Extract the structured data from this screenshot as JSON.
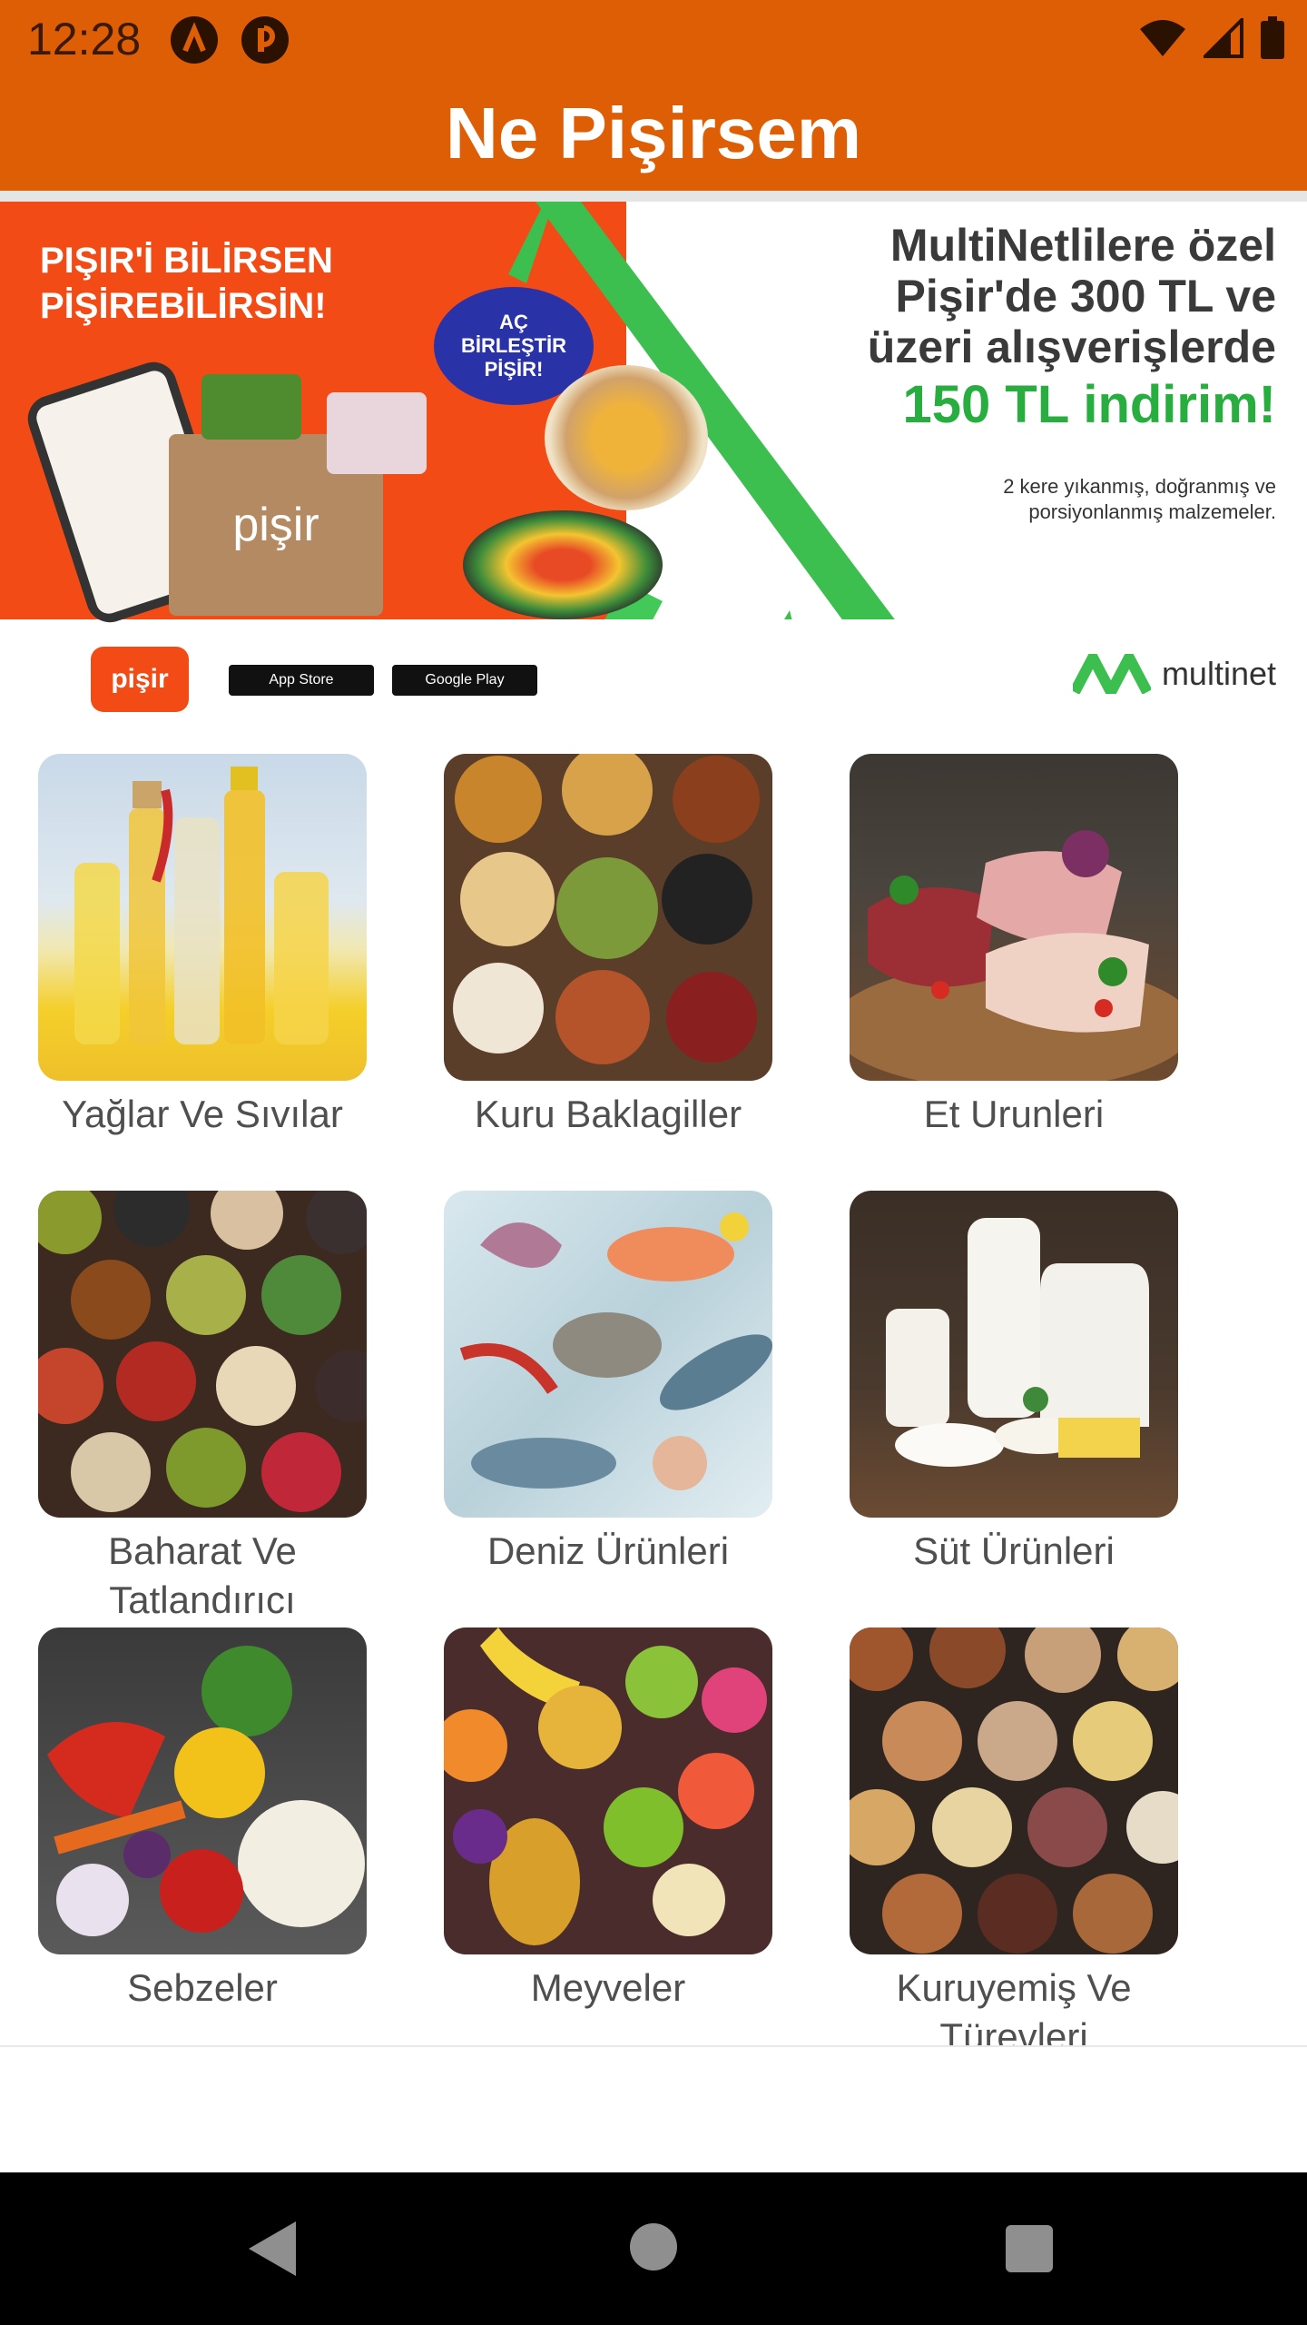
{
  "status_bar": {
    "time": "12:28",
    "left_icons": [
      "a-circle-icon",
      "p-circle-icon"
    ],
    "right_icons": [
      "wifi-icon",
      "signal-icon",
      "battery-icon"
    ]
  },
  "app_bar": {
    "title": "Ne Pişirsem"
  },
  "banner": {
    "headline_line1": "PIŞIR'İ BİLİRSEN",
    "headline_line2": "PİŞİREBİLİRSİN!",
    "badge_line1": "AÇ",
    "badge_line2": "BİRLEŞTİR",
    "badge_line3": "PİŞİR!",
    "bag_text": "pişir",
    "offer_line1": "MultiNetlilere özel",
    "offer_line2": "Pişir'de 300 TL ve",
    "offer_line3": "üzeri alışverişlerde",
    "offer_highlight": "150 TL indirim!",
    "note_line1": "2 kere yıkanmış, doğranmış ve",
    "note_line2": "porsiyonlanmış malzemeler.",
    "pisir_logo": "pişir",
    "app_store": "App Store",
    "google_play": "Google Play",
    "multinet_logo": "multinet",
    "colors": {
      "orange": "#f24b16",
      "green": "#27ae3f",
      "blue": "#2a32a8"
    }
  },
  "categories": [
    {
      "label": "Yağlar Ve Sıvılar"
    },
    {
      "label": "Kuru Baklagiller"
    },
    {
      "label": "Et Urunleri"
    },
    {
      "label": "Baharat Ve Tatlandırıcı"
    },
    {
      "label": "Deniz Ürünleri"
    },
    {
      "label": "Süt Ürünleri"
    },
    {
      "label": "Sebzeler"
    },
    {
      "label": "Meyveler"
    },
    {
      "label": "Kuruyemiş Ve Türevleri"
    }
  ],
  "nav_bar": {
    "icons": [
      "back-icon",
      "home-icon",
      "recents-icon"
    ]
  },
  "theme": {
    "primary": "#de5e05",
    "label_text": "#4f4f4f"
  }
}
